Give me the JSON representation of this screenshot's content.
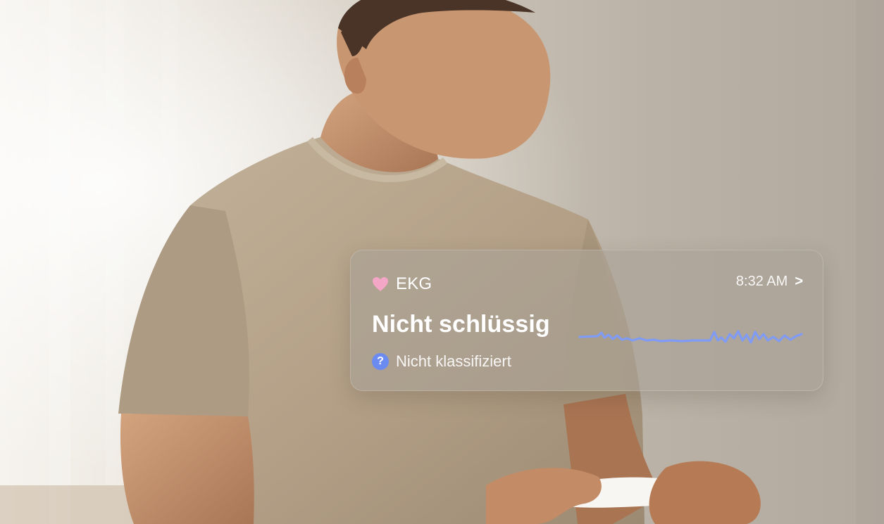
{
  "ekg_card": {
    "label": "EKG",
    "time": "8:32 AM",
    "result": "Nicht schlüssig",
    "classification": "Nicht klassifiziert",
    "icons": {
      "title": "heart-icon",
      "status": "question-icon",
      "navigation": "chevron-right-icon"
    },
    "chevron_glyph": ">",
    "question_glyph": "?",
    "colors": {
      "heart": "#f4a6c6",
      "wave": "#7f9bf6",
      "status_icon": "#6b8bf0",
      "text": "#ffffff"
    }
  }
}
